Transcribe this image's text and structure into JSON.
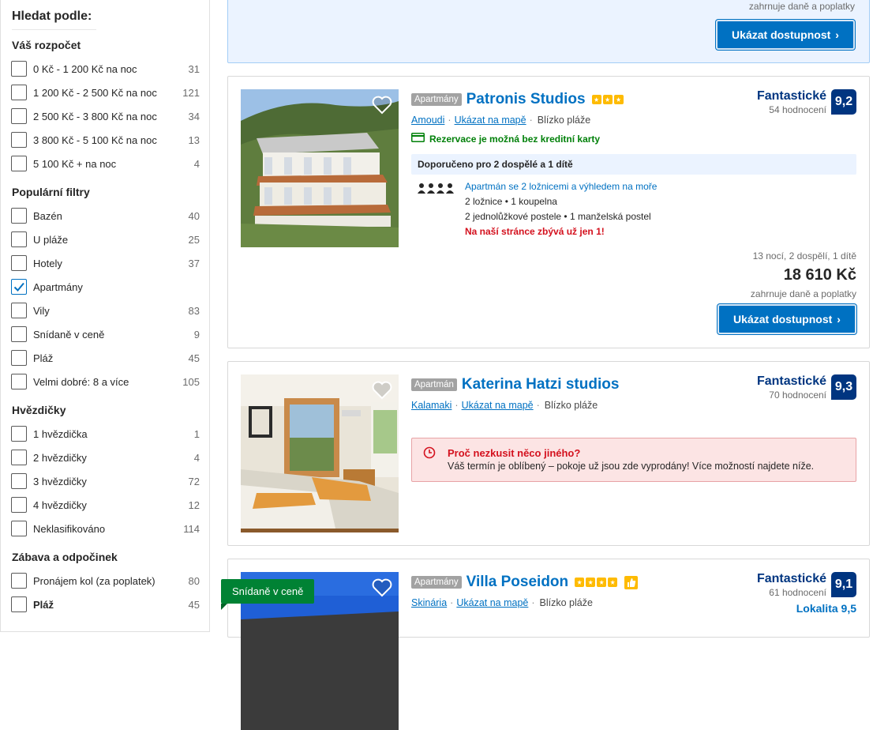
{
  "sidebar": {
    "title": "Hledat podle:",
    "groups": [
      {
        "title": "Váš rozpočet",
        "items": [
          {
            "label": "0 Kč - 1 200 Kč na noc",
            "count": "31",
            "checked": false
          },
          {
            "label": "1 200 Kč - 2 500 Kč na noc",
            "count": "121",
            "checked": false
          },
          {
            "label": "2 500 Kč - 3 800 Kč na noc",
            "count": "34",
            "checked": false
          },
          {
            "label": "3 800 Kč - 5 100 Kč na noc",
            "count": "13",
            "checked": false
          },
          {
            "label": "5 100 Kč + na noc",
            "count": "4",
            "checked": false
          }
        ]
      },
      {
        "title": "Populární filtry",
        "items": [
          {
            "label": "Bazén",
            "count": "40",
            "checked": false
          },
          {
            "label": "U pláže",
            "count": "25",
            "checked": false
          },
          {
            "label": "Hotely",
            "count": "37",
            "checked": false
          },
          {
            "label": "Apartmány",
            "count": "",
            "checked": true
          },
          {
            "label": "Vily",
            "count": "83",
            "checked": false
          },
          {
            "label": "Snídaně v ceně",
            "count": "9",
            "checked": false
          },
          {
            "label": "Pláž",
            "count": "45",
            "checked": false
          },
          {
            "label": "Velmi dobré: 8 a více",
            "count": "105",
            "checked": false
          }
        ]
      },
      {
        "title": "Hvězdičky",
        "items": [
          {
            "label": "1 hvězdička",
            "count": "1",
            "checked": false
          },
          {
            "label": "2 hvězdičky",
            "count": "4",
            "checked": false
          },
          {
            "label": "3 hvězdičky",
            "count": "72",
            "checked": false
          },
          {
            "label": "4 hvězdičky",
            "count": "12",
            "checked": false
          },
          {
            "label": "Neklasifikováno",
            "count": "114",
            "checked": false
          }
        ]
      },
      {
        "title": "Zábava a odpočinek",
        "items": [
          {
            "label": "Pronájem kol (za poplatek)",
            "count": "80",
            "checked": false
          },
          {
            "label": "Pláž",
            "count": "45",
            "checked": false,
            "bold": true
          }
        ]
      }
    ]
  },
  "top_card": {
    "tax_note": "zahrnuje daně a poplatky",
    "button_label": "Ukázat dostupnost"
  },
  "cards": [
    {
      "type": "Apartmány",
      "name": "Patronis Studios",
      "stars": 3,
      "location": "Amoudi",
      "map_link": "Ukázat na mapě",
      "beach": "Blízko pláže",
      "no_card": "Rezervace je možná bez kreditní karty",
      "recommended": "Doporučeno pro 2 dospělé a 1 dítě",
      "room_name": "Apartmán se 2 ložnicemi a výhledem na moře",
      "room_line1": "2 ložnice • 1 koupelna",
      "room_line2": "2 jednolůžkové postele • 1 manželská postel",
      "room_warning": "Na naší stránce zbývá už jen 1!",
      "rating_label": "Fantastické",
      "rating_count": "54 hodnocení",
      "score": "9,2",
      "stay": "13 nocí, 2 dospělí, 1 dítě",
      "price": "18 610 Kč",
      "tax_note": "zahrnuje daně a poplatky",
      "button_label": "Ukázat dostupnost"
    },
    {
      "type": "Apartmán",
      "name": "Katerina Hatzi studios",
      "location": "Kalamaki",
      "map_link": "Ukázat na mapě",
      "beach": "Blízko pláže",
      "alert_title": "Proč nezkusit něco jiného?",
      "alert_text": "Váš termín je oblíbený – pokoje už jsou zde vyprodány! Více možností najdete níže.",
      "rating_label": "Fantastické",
      "rating_count": "70 hodnocení",
      "score": "9,3"
    },
    {
      "type": "Apartmány",
      "name": "Villa Poseidon",
      "stars": 4,
      "location": "Skinária",
      "map_link": "Ukázat na mapě",
      "beach": "Blízko pláže",
      "rating_label": "Fantastické",
      "rating_count": "61 hodnocení",
      "score": "9,1",
      "location_score": "Lokalita 9,5",
      "badge": "Snídaně v ceně"
    }
  ],
  "colors": {
    "link": "#0071c2",
    "navy": "#003580",
    "star": "#febb02",
    "green": "#008009",
    "red": "#d4111e"
  }
}
